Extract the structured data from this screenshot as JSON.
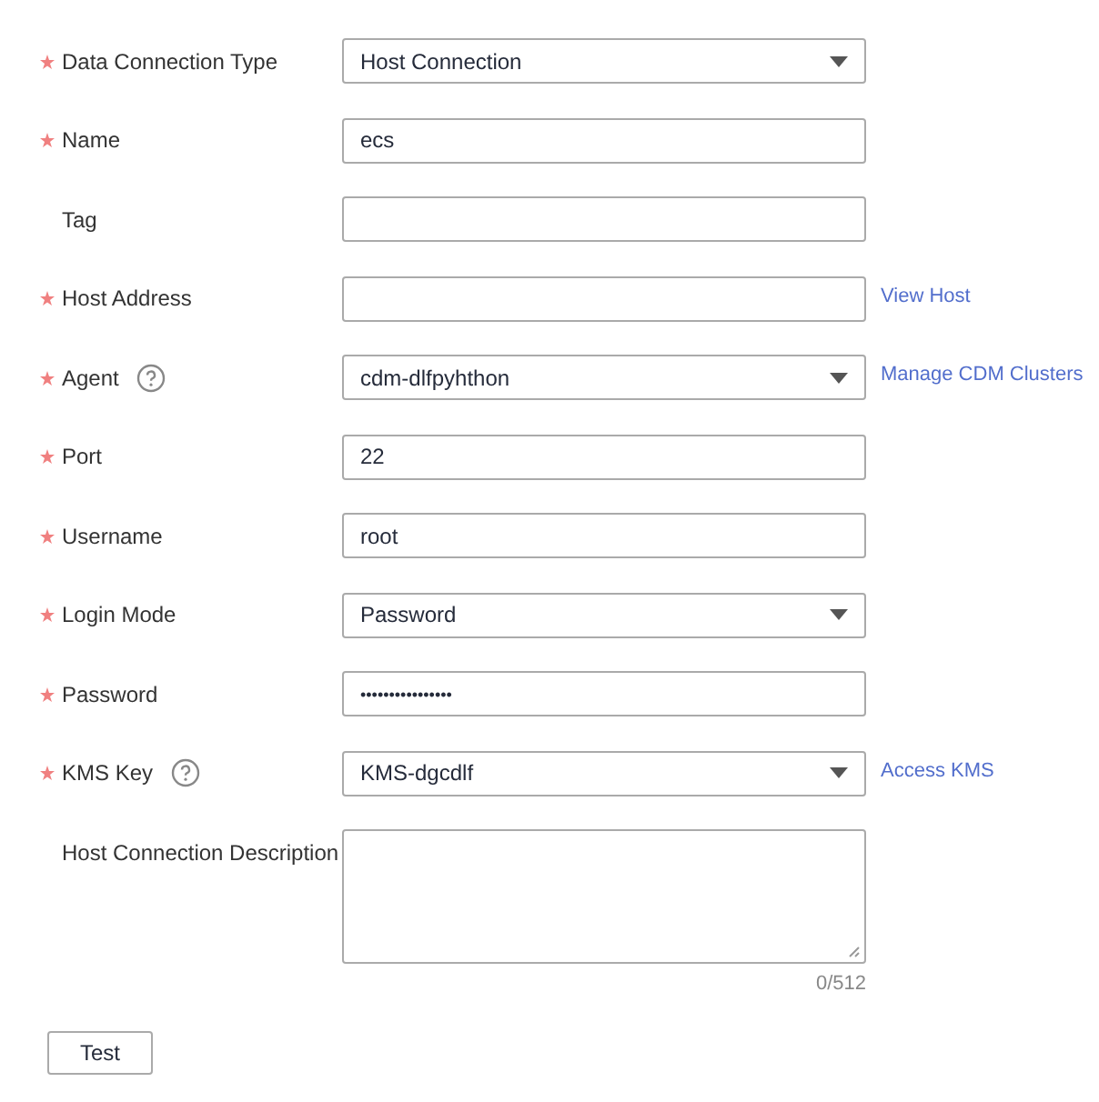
{
  "fields": [
    {
      "kind": "select",
      "label": "Data Connection Type",
      "required": true,
      "help": false,
      "value": "Host Connection"
    },
    {
      "kind": "input",
      "label": "Name",
      "required": true,
      "help": false,
      "value": "ecs"
    },
    {
      "kind": "input",
      "label": "Tag",
      "required": false,
      "help": false
    },
    {
      "kind": "input",
      "label": "Host Address",
      "required": true,
      "help": false,
      "link": "View Host"
    },
    {
      "kind": "select",
      "label": "Agent",
      "required": true,
      "help": true,
      "value": "cdm-dlfpyhthon",
      "link": "Manage CDM Clusters"
    },
    {
      "kind": "input",
      "label": "Port",
      "required": true,
      "help": false,
      "value": "22"
    },
    {
      "kind": "input",
      "label": "Username",
      "required": true,
      "help": false,
      "value": "root"
    },
    {
      "kind": "select",
      "label": "Login Mode",
      "required": true,
      "help": false,
      "value": "Password"
    },
    {
      "kind": "password",
      "label": "Password",
      "required": true,
      "help": false,
      "value": "••••••••••••••••"
    },
    {
      "kind": "select",
      "label": "KMS Key",
      "required": true,
      "help": true,
      "value": "KMS-dgcdlf",
      "link": "Access KMS"
    },
    {
      "kind": "textarea",
      "label": "Host Connection Description",
      "required": false,
      "help": false,
      "counter": "0/512"
    }
  ],
  "buttons": [
    "Test"
  ]
}
